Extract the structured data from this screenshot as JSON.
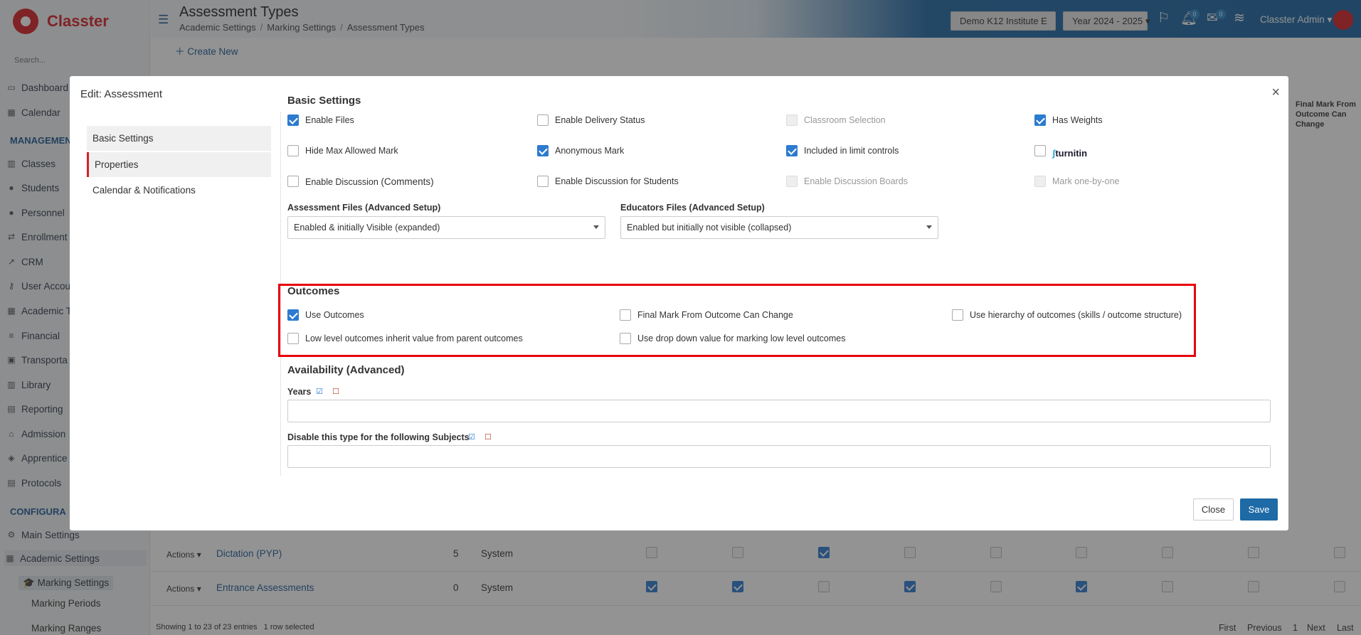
{
  "app": {
    "name": "Classter"
  },
  "sidebar": {
    "search_placeholder": "Search...",
    "items": [
      {
        "label": "Dashboard",
        "icon": "laptop-icon"
      },
      {
        "label": "Calendar",
        "icon": "calendar-icon"
      },
      {
        "label": "Classes",
        "icon": "classes-icon"
      },
      {
        "label": "Students",
        "icon": "students-icon"
      },
      {
        "label": "Personnel",
        "icon": "personnel-icon"
      },
      {
        "label": "Enrollment",
        "icon": "enrollment-icon"
      },
      {
        "label": "CRM",
        "icon": "crm-icon"
      },
      {
        "label": "User Accou",
        "icon": "key-icon"
      },
      {
        "label": "Academic T",
        "icon": "grid-icon"
      },
      {
        "label": "Financial",
        "icon": "coins-icon"
      },
      {
        "label": "Transporta",
        "icon": "bus-icon"
      },
      {
        "label": "Library",
        "icon": "library-icon"
      },
      {
        "label": "Reporting",
        "icon": "printer-icon"
      },
      {
        "label": "Admission",
        "icon": "building-icon"
      },
      {
        "label": "Apprentice",
        "icon": "apprentice-icon"
      },
      {
        "label": "Protocols",
        "icon": "protocols-icon"
      }
    ],
    "group_management": "MANAGEMEN",
    "group_configuration": "CONFIGURA",
    "config_items": [
      {
        "label": "Main Settings"
      },
      {
        "label": "Academic Settings"
      },
      {
        "label": "Marking Settings"
      },
      {
        "label": "Marking Periods"
      },
      {
        "label": "Marking Ranges"
      }
    ]
  },
  "header": {
    "title": "Assessment Types",
    "breadcrumbs": [
      "Academic Settings",
      "Marking Settings",
      "Assessment Types"
    ],
    "institute": "Demo K12 Institute E",
    "year": "Year 2024 - 2025",
    "notifications_count": "0",
    "messages_count": "0",
    "user": "Classter Admin"
  },
  "toolbar": {
    "create_label": "Create New"
  },
  "table": {
    "column_header": "Final Mark From Outcome Can Change",
    "rows": [
      {
        "action": "Actions",
        "name": "Dictation (PYP)",
        "count": "5",
        "type": "System",
        "checks": [
          false,
          false,
          true,
          false,
          false,
          false,
          false,
          false,
          false
        ]
      },
      {
        "action": "Actions",
        "name": "Entrance Assessments",
        "count": "0",
        "type": "System",
        "checks": [
          true,
          true,
          false,
          true,
          false,
          true,
          false,
          false,
          false
        ]
      }
    ],
    "info": "Showing 1 to 23 of 23 entries",
    "selected": "1 row selected",
    "pager": {
      "first": "First",
      "previous": "Previous",
      "page": "1",
      "next": "Next",
      "last": "Last"
    }
  },
  "modal": {
    "title": "Edit: Assessment",
    "tabs": [
      "Basic Settings",
      "Properties",
      "Calendar & Notifications"
    ],
    "basic": {
      "heading": "Basic Settings",
      "options": {
        "enable_files": "Enable Files",
        "enable_delivery_status": "Enable Delivery Status",
        "classroom_selection": "Classroom Selection",
        "has_weights": "Has Weights",
        "hide_max_allowed_mark": "Hide Max Allowed Mark",
        "anonymous_mark": "Anonymous Mark",
        "included_in_limit_controls": "Included in limit controls",
        "turnitin": "turnitin",
        "enable_discussion": "Enable Discussion",
        "enable_discussion_suffix": "(Comments)",
        "enable_discussion_students": "Enable Discussion for Students",
        "enable_discussion_boards": "Enable Discussion Boards",
        "mark_one_by_one": "Mark one-by-one"
      },
      "assessment_files_label": "Assessment Files (Advanced Setup)",
      "assessment_files_value": "Enabled & initially Visible (expanded)",
      "educators_files_label": "Educators Files (Advanced Setup)",
      "educators_files_value": "Enabled but initially not visible (collapsed)"
    },
    "outcomes": {
      "heading": "Outcomes",
      "use_outcomes": "Use Outcomes",
      "final_mark_can_change": "Final Mark From Outcome Can Change",
      "use_hierarchy": "Use hierarchy of outcomes (skills / outcome structure)",
      "low_level_inherit": "Low level outcomes inherit value from parent outcomes",
      "use_dropdown": "Use drop down value for marking low level outcomes"
    },
    "availability": {
      "heading": "Availability (Advanced)",
      "years_label": "Years",
      "subjects_label": "Disable this type for the following Subjects"
    },
    "buttons": {
      "close": "Close",
      "save": "Save"
    }
  },
  "colors": {
    "brand_red": "#d71f26",
    "primary_blue": "#1d5a96",
    "save_blue": "#1e6aa6",
    "highlight_red": "#e8000b"
  }
}
